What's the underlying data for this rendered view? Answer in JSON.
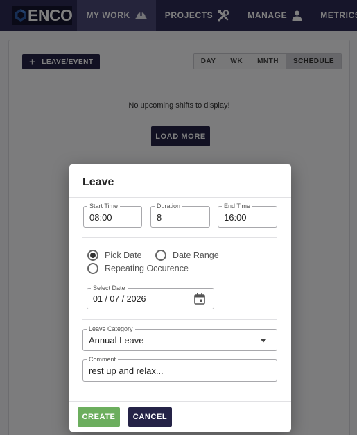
{
  "brand": {
    "logo_text": "ENCO"
  },
  "nav": {
    "items": [
      {
        "label": "MY WORK",
        "icon": "hard-hat-icon",
        "active": true
      },
      {
        "label": "PROJECTS",
        "icon": "tools-icon",
        "active": false
      },
      {
        "label": "MANAGE",
        "icon": "person-icon",
        "active": false
      },
      {
        "label": "METRICS",
        "icon": "",
        "active": false
      }
    ]
  },
  "page": {
    "leave_button": "LEAVE/EVENT",
    "view_tabs": [
      "DAY",
      "WK",
      "MNTH",
      "SCHEDULE"
    ],
    "selected_tab": "SCHEDULE",
    "empty_message": "No upcoming shifts to display!",
    "load_more": "LOAD MORE"
  },
  "dialog": {
    "title": "Leave",
    "start_time": {
      "label": "Start Time",
      "value": "08:00"
    },
    "duration": {
      "label": "Duration",
      "value": "8"
    },
    "end_time": {
      "label": "End Time",
      "value": "16:00"
    },
    "radios": [
      {
        "label": "Pick Date",
        "checked": true
      },
      {
        "label": "Date Range",
        "checked": false
      },
      {
        "label": "Repeating Occurence",
        "checked": false
      }
    ],
    "select_date": {
      "label": "Select Date",
      "value": "01 / 07 / 2026"
    },
    "leave_category": {
      "label": "Leave Category",
      "value": "Annual Leave"
    },
    "comment": {
      "label": "Comment",
      "value": "rest up and relax..."
    },
    "create_label": "CREATE",
    "cancel_label": "CANCEL"
  },
  "colors": {
    "nav_bg": "#2c2a55",
    "primary_dark": "#252347",
    "create_green": "#6cae5e"
  }
}
